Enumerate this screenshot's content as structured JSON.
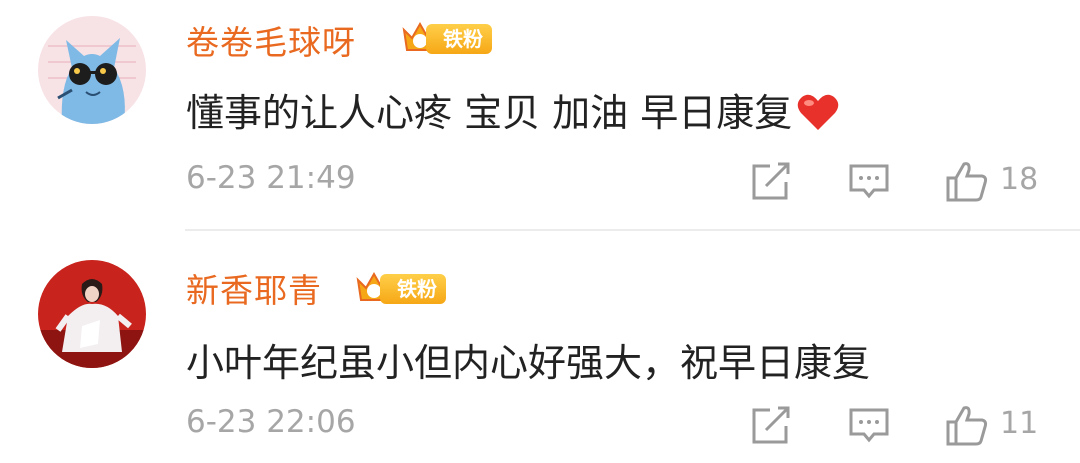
{
  "comments": [
    {
      "username": "卷卷毛球呀",
      "badge_level": "3",
      "badge_label": "铁粉",
      "text": "懂事的让人心疼 宝贝 加油 早日康复",
      "emoji": "heart-emoji",
      "timestamp": "6-23 21:49",
      "likes": "18"
    },
    {
      "username": "新香耶青",
      "badge_level": "4",
      "badge_label": "铁粉",
      "text": "小叶年纪虽小但内心好强大，祝早日康复",
      "timestamp": "6-23 22:06",
      "likes": "11"
    }
  ],
  "colors": {
    "username": "#e8691f",
    "badge_gold": "#f6a716",
    "meta_gray": "#a6a6a6",
    "body_text": "#222222",
    "heart": "#e8312b"
  },
  "icons": [
    "share-icon",
    "comment-icon",
    "thumbs-up-icon",
    "crown-icon"
  ]
}
